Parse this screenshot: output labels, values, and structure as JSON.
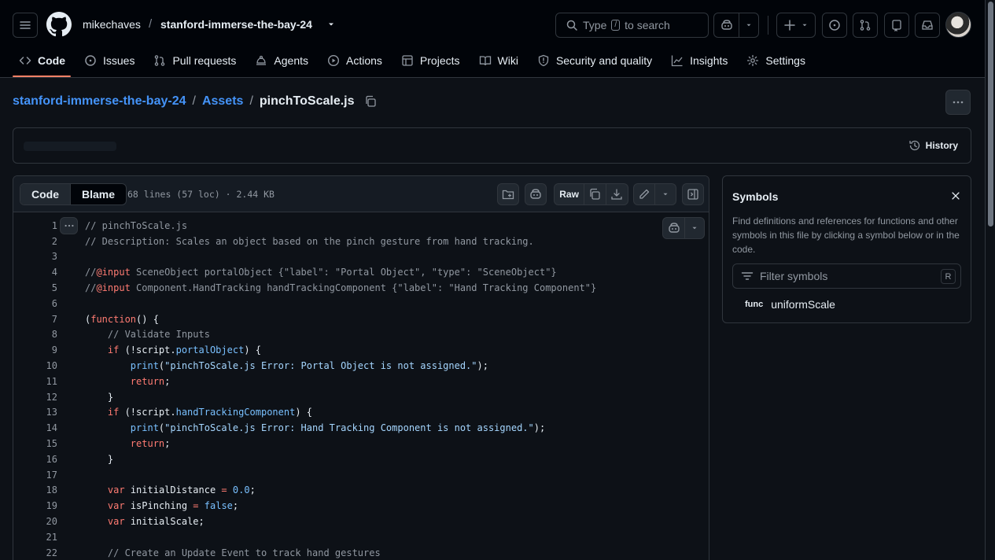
{
  "header": {
    "owner": "mikechaves",
    "separator": "/",
    "repo": "stanford-immerse-the-bay-24",
    "search_pre": "Type",
    "search_key": "/",
    "search_post": "to search"
  },
  "nav": {
    "items": [
      {
        "label": "Code",
        "icon": "code-icon"
      },
      {
        "label": "Issues",
        "icon": "issue-icon"
      },
      {
        "label": "Pull requests",
        "icon": "pull-request-icon"
      },
      {
        "label": "Agents",
        "icon": "agent-icon"
      },
      {
        "label": "Actions",
        "icon": "play-icon"
      },
      {
        "label": "Projects",
        "icon": "table-icon"
      },
      {
        "label": "Wiki",
        "icon": "book-icon"
      },
      {
        "label": "Security and quality",
        "icon": "shield-icon"
      },
      {
        "label": "Insights",
        "icon": "graph-icon"
      },
      {
        "label": "Settings",
        "icon": "gear-icon"
      }
    ]
  },
  "path": {
    "repo": "stanford-immerse-the-bay-24",
    "folder": "Assets",
    "file": "pinchToScale.js",
    "sep": "/"
  },
  "commit": {
    "history_label": "History"
  },
  "code_header": {
    "tab_code": "Code",
    "tab_blame": "Blame",
    "file_info": "68 lines (57 loc) · 2.44 KB",
    "raw_label": "Raw"
  },
  "code_lines": [
    "1",
    "2",
    "3",
    "4",
    "5",
    "6",
    "7",
    "8",
    "9",
    "10",
    "11",
    "12",
    "13",
    "14",
    "15",
    "16",
    "17",
    "18",
    "19",
    "20",
    "21",
    "22"
  ],
  "symbols": {
    "title": "Symbols",
    "description": "Find definitions and references for functions and other symbols in this file by clicking a symbol below or in the code.",
    "filter_placeholder": "Filter symbols",
    "filter_key": "R",
    "items": [
      {
        "kind": "func",
        "name": "uniformScale"
      }
    ]
  },
  "colors": {
    "accent_link": "#4493f8",
    "nav_underline": "#f78166",
    "keyword": "#ff7b72",
    "string": "#a5d6ff",
    "property": "#79c0ff",
    "function": "#d2a8ff"
  }
}
